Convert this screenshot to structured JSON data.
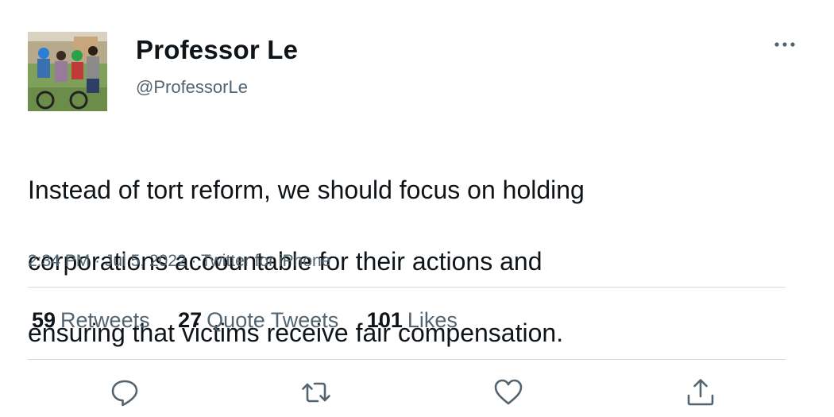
{
  "author": {
    "display_name": "Professor Le",
    "handle": "@ProfessorLe",
    "avatar": "family-photo-with-bikes"
  },
  "tweet": {
    "text_lines": [
      "Instead of tort reform, we should focus on holding",
      "corporations accountable for their actions and",
      "ensuring that victims receive fair compensation."
    ],
    "time": "2:34 PM",
    "separator": "·",
    "date": "Jul 5, 2022",
    "source": "Twitter for iPhone"
  },
  "stats": {
    "retweets": {
      "count": "59",
      "label": "Retweets"
    },
    "quote_tweets": {
      "count": "27",
      "label": "Quote Tweets"
    },
    "likes": {
      "count": "101",
      "label": "Likes"
    }
  },
  "actions": [
    {
      "icon": "reply-icon"
    },
    {
      "icon": "retweet-icon"
    },
    {
      "icon": "like-icon"
    },
    {
      "icon": "share-icon"
    }
  ],
  "colors": {
    "text": "#0f1419",
    "secondary": "#536471",
    "divider": "#cfd9de"
  }
}
